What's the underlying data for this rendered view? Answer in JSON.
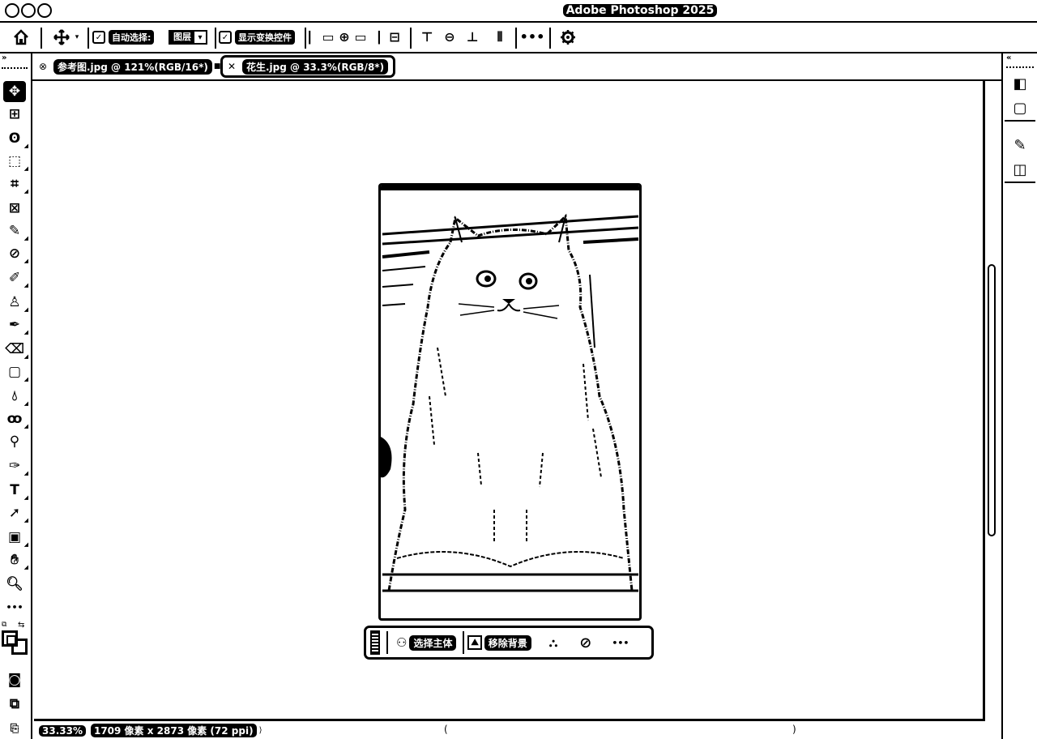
{
  "app": {
    "title": "Adobe Photoshop 2025"
  },
  "options_bar": {
    "auto_select_label": "自动选择:",
    "auto_select_target": "图层",
    "show_transform_label": "显示变换控件"
  },
  "tabs": [
    {
      "label": "参考图.jpg @ 121%(RGB/16*)",
      "active": false
    },
    {
      "label": "花生.jpg @ 33.3%(RGB/8*)",
      "active": true
    }
  ],
  "contextual_taskbar": {
    "select_subject_label": "选择主体",
    "remove_background_label": "移除背景"
  },
  "status_bar": {
    "zoom": "33.33%",
    "doc_info": "1709 像素 x 2873 像素 (72 ppi)"
  },
  "icons": {
    "home": "home-icon",
    "move": "move-icon",
    "settings": "gear-icon"
  },
  "colors": {
    "ink": "#000000",
    "paper": "#ffffff"
  }
}
